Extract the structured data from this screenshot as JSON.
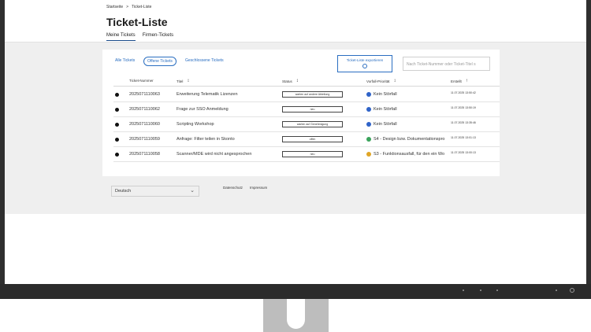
{
  "breadcrumb": {
    "home": "Startseite",
    "separator": ">",
    "current": "Ticket-Liste"
  },
  "page": {
    "title": "Ticket-Liste"
  },
  "tabs": [
    {
      "label": "Meine Tickets"
    },
    {
      "label": "Firmen-Tickets"
    }
  ],
  "filters": [
    {
      "label": "Alle Tickets"
    },
    {
      "label": "Offene Tickets"
    },
    {
      "label": "Geschlossene Tickets"
    }
  ],
  "toolbar": {
    "export_label": "Ticket-Liste exportieren",
    "search_placeholder": "Nach Ticket-Nummer oder Ticket-Titel s"
  },
  "table": {
    "headers": {
      "number": "Ticket-Nummer",
      "title": "Titel",
      "status": "Status",
      "priority": "Vorfall-Priorität",
      "created": "Erstellt"
    },
    "rows": [
      {
        "number": "2025071110063",
        "title": "Erweiterung Telematik Lizenzen",
        "status": "warten auf andere Abteilung",
        "priority": "Kein Störfall",
        "priority_color": "#2f63c8",
        "created": "11.07.2025 13:50:42"
      },
      {
        "number": "2025071110062",
        "title": "Frage zur SSO Anmeldung",
        "status": "neu",
        "priority": "Kein Störfall",
        "priority_color": "#2f63c8",
        "created": "11.07.2025 13:50:19"
      },
      {
        "number": "2025071110060",
        "title": "Scripting Workshop",
        "status": "warten auf Genehmigung",
        "priority": "Kein Störfall",
        "priority_color": "#2f63c8",
        "created": "11.07.2025 13:35:46"
      },
      {
        "number": "2025071110059",
        "title": "Anfrage: Filter teilen in Skonto",
        "status": "offen",
        "priority": "S4 - Design bzw. Dokumentationspro",
        "priority_color": "#3aa35b",
        "created": "11.07.2025 13:01:13"
      },
      {
        "number": "2025071110058",
        "title": "Scanner/MDE wird nicht angesprochen",
        "status": "neu",
        "priority": "S3 - Funktionsausfall, für den ein Wo",
        "priority_color": "#e0a526",
        "created": "11.07.2025 13:00:13"
      }
    ]
  },
  "footer": {
    "language": "Deutsch",
    "privacy": "Datenschutz",
    "imprint": "Impressum"
  }
}
